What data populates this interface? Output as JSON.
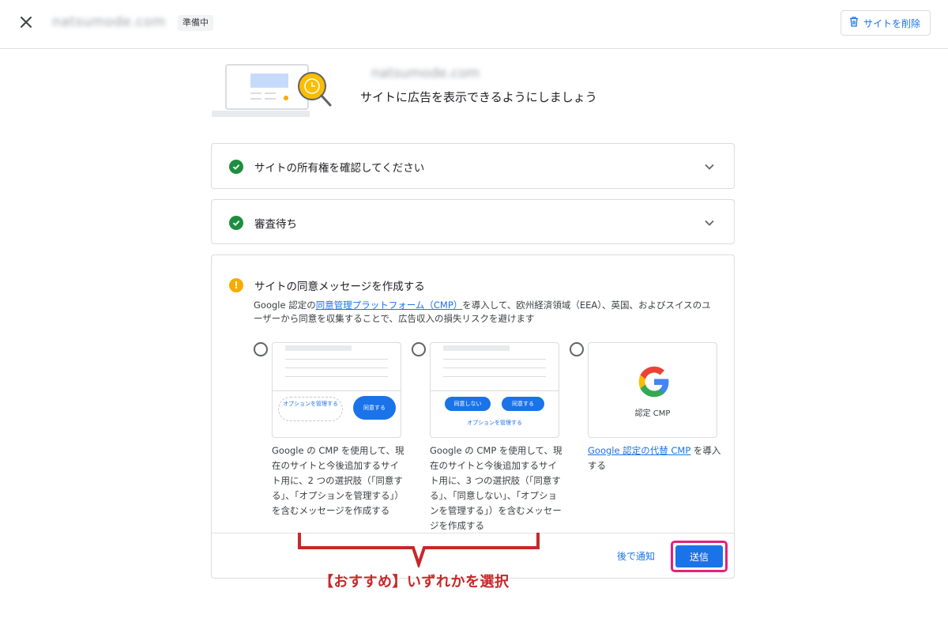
{
  "topbar": {
    "site_name": "natsumode.com",
    "status_badge": "準備中",
    "delete_button": "サイトを削除"
  },
  "hero": {
    "site_name": "natsumode.com",
    "subtitle": "サイトに広告を表示できるようにしましょう"
  },
  "steps": [
    {
      "title": "サイトの所有権を確認してください",
      "status": "done"
    },
    {
      "title": "審査待ち",
      "status": "done"
    },
    {
      "title": "サイトの同意メッセージを作成する",
      "status": "warning",
      "desc_before": "Google 認定の",
      "desc_link": "同意管理プラットフォーム（CMP）",
      "desc_after": "を導入して、欧州経済領域（EEA）、英国、およびスイスのユーザーから同意を収集することで、広告収入の損失リスクを避けます"
    }
  ],
  "options": [
    {
      "preview_buttons": [
        "オプションを管理する",
        "同意する"
      ],
      "text": "Google の CMP を使用して、現在のサイトと今後追加するサイト用に、2 つの選択肢（「同意する」、「オプションを管理する」）を含むメッセージを作成する"
    },
    {
      "preview_buttons": [
        "同意しない",
        "同意する"
      ],
      "preview_link": "オプションを管理する",
      "text": "Google の CMP を使用して、現在のサイトと今後追加するサイト用に、3 つの選択肢（「同意する」、「同意しない」、「オプションを管理する」）を含むメッセージを作成する"
    },
    {
      "preview_label": "認定 CMP",
      "text_link": "Google 認定の代替 CMP",
      "text_after": " を導入する"
    }
  ],
  "footer": {
    "later_button": "後で通知",
    "send_button": "送信"
  },
  "annotation": {
    "callout": "【おすすめ】いずれかを選択"
  },
  "colors": {
    "primary": "#1a73e8",
    "success": "#1e8e3e",
    "warning": "#f9ab00",
    "highlight": "#e3217b",
    "annotation": "#c62828"
  }
}
